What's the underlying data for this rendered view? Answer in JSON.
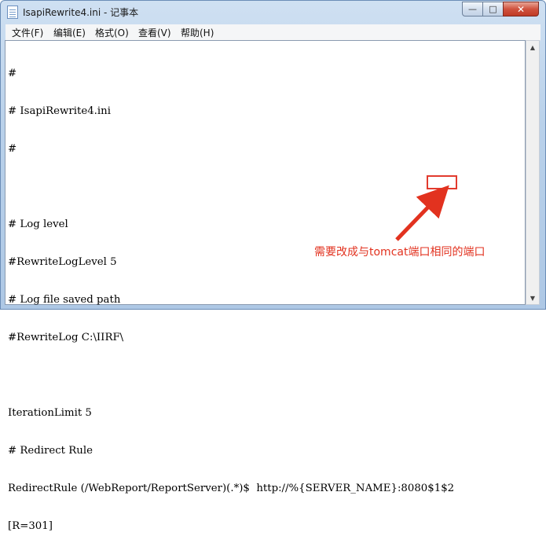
{
  "window": {
    "title": "IsapiRewrite4.ini - 记事本",
    "controls": {
      "minimize": "—",
      "maximize": "□",
      "close": "✕"
    }
  },
  "menu": [
    "文件(F)",
    "编辑(E)",
    "格式(O)",
    "查看(V)",
    "帮助(H)"
  ],
  "editor": {
    "lines": [
      "#",
      "# IsapiRewrite4.ini",
      "#",
      "",
      "# Log level",
      "#RewriteLogLevel 5",
      "# Log file saved path",
      "#RewriteLog C:\\IIRF\\",
      "",
      "IterationLimit 5",
      "# Redirect Rule",
      "RedirectRule (/WebReport/ReportServer)(.*)$  http://%{SERVER_NAME}:8080$1$2",
      "[R=301]"
    ]
  },
  "annotation": {
    "highlighted_text": "8080",
    "note": "需要改成与tomcat端口相同的端口",
    "color": "#e2321f"
  },
  "icons": [
    "notepad-icon",
    "scroll-up-icon",
    "scroll-down-icon",
    "arrow-icon"
  ]
}
